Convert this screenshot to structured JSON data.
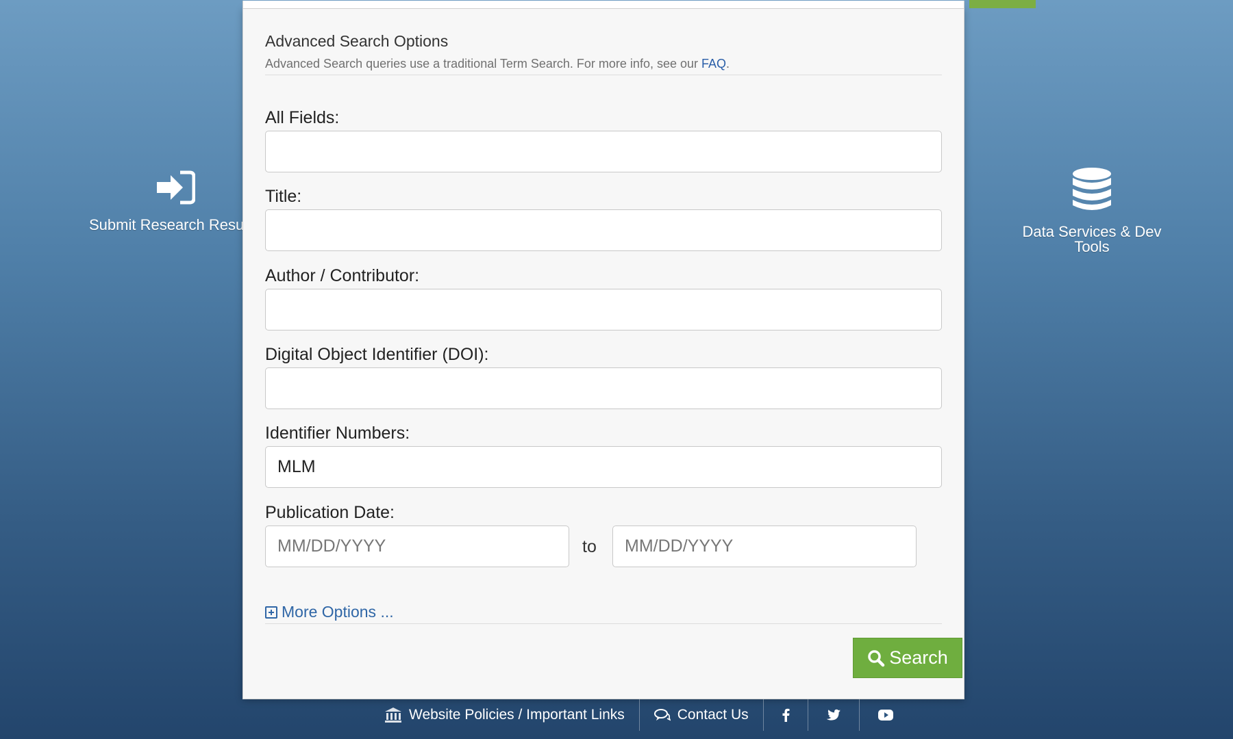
{
  "background": {
    "left_tile": {
      "label": "Submit Research Resu",
      "icon": "sign-in-icon"
    },
    "right_tile": {
      "label_line1": "Data Services & Dev",
      "label_line2": "Tools",
      "icon": "database-icon"
    }
  },
  "advanced_search": {
    "title": "Advanced Search Options",
    "subtitle_prefix": "Advanced Search queries use a traditional Term Search. For more info, see our ",
    "subtitle_link": "FAQ",
    "subtitle_suffix": "."
  },
  "fields": {
    "all_fields": {
      "label": "All Fields:",
      "value": ""
    },
    "title": {
      "label": "Title:",
      "value": ""
    },
    "author": {
      "label": "Author / Contributor:",
      "value": ""
    },
    "doi": {
      "label": "Digital Object Identifier (DOI):",
      "value": ""
    },
    "identifier": {
      "label": "Identifier Numbers:",
      "value": "MLM"
    },
    "publication_date": {
      "label": "Publication Date:",
      "from_placeholder": "MM/DD/YYYY",
      "to_label": "to",
      "to_placeholder": "MM/DD/YYYY"
    }
  },
  "more_options": {
    "label": "More Options ...",
    "icon": "plus-square-icon"
  },
  "search_button": {
    "label": "Search",
    "icon": "search-icon"
  },
  "footer": {
    "policies": {
      "label": "Website Policies / Important Links",
      "icon": "institution-icon"
    },
    "contact": {
      "label": "Contact Us",
      "icon": "comments-icon"
    },
    "social": [
      "facebook-icon",
      "twitter-icon",
      "youtube-icon"
    ]
  },
  "colors": {
    "accent_green": "#6fae3f",
    "link_blue": "#2a5ea8",
    "background_top": "#6d9cc2",
    "background_bottom": "#23456c"
  }
}
